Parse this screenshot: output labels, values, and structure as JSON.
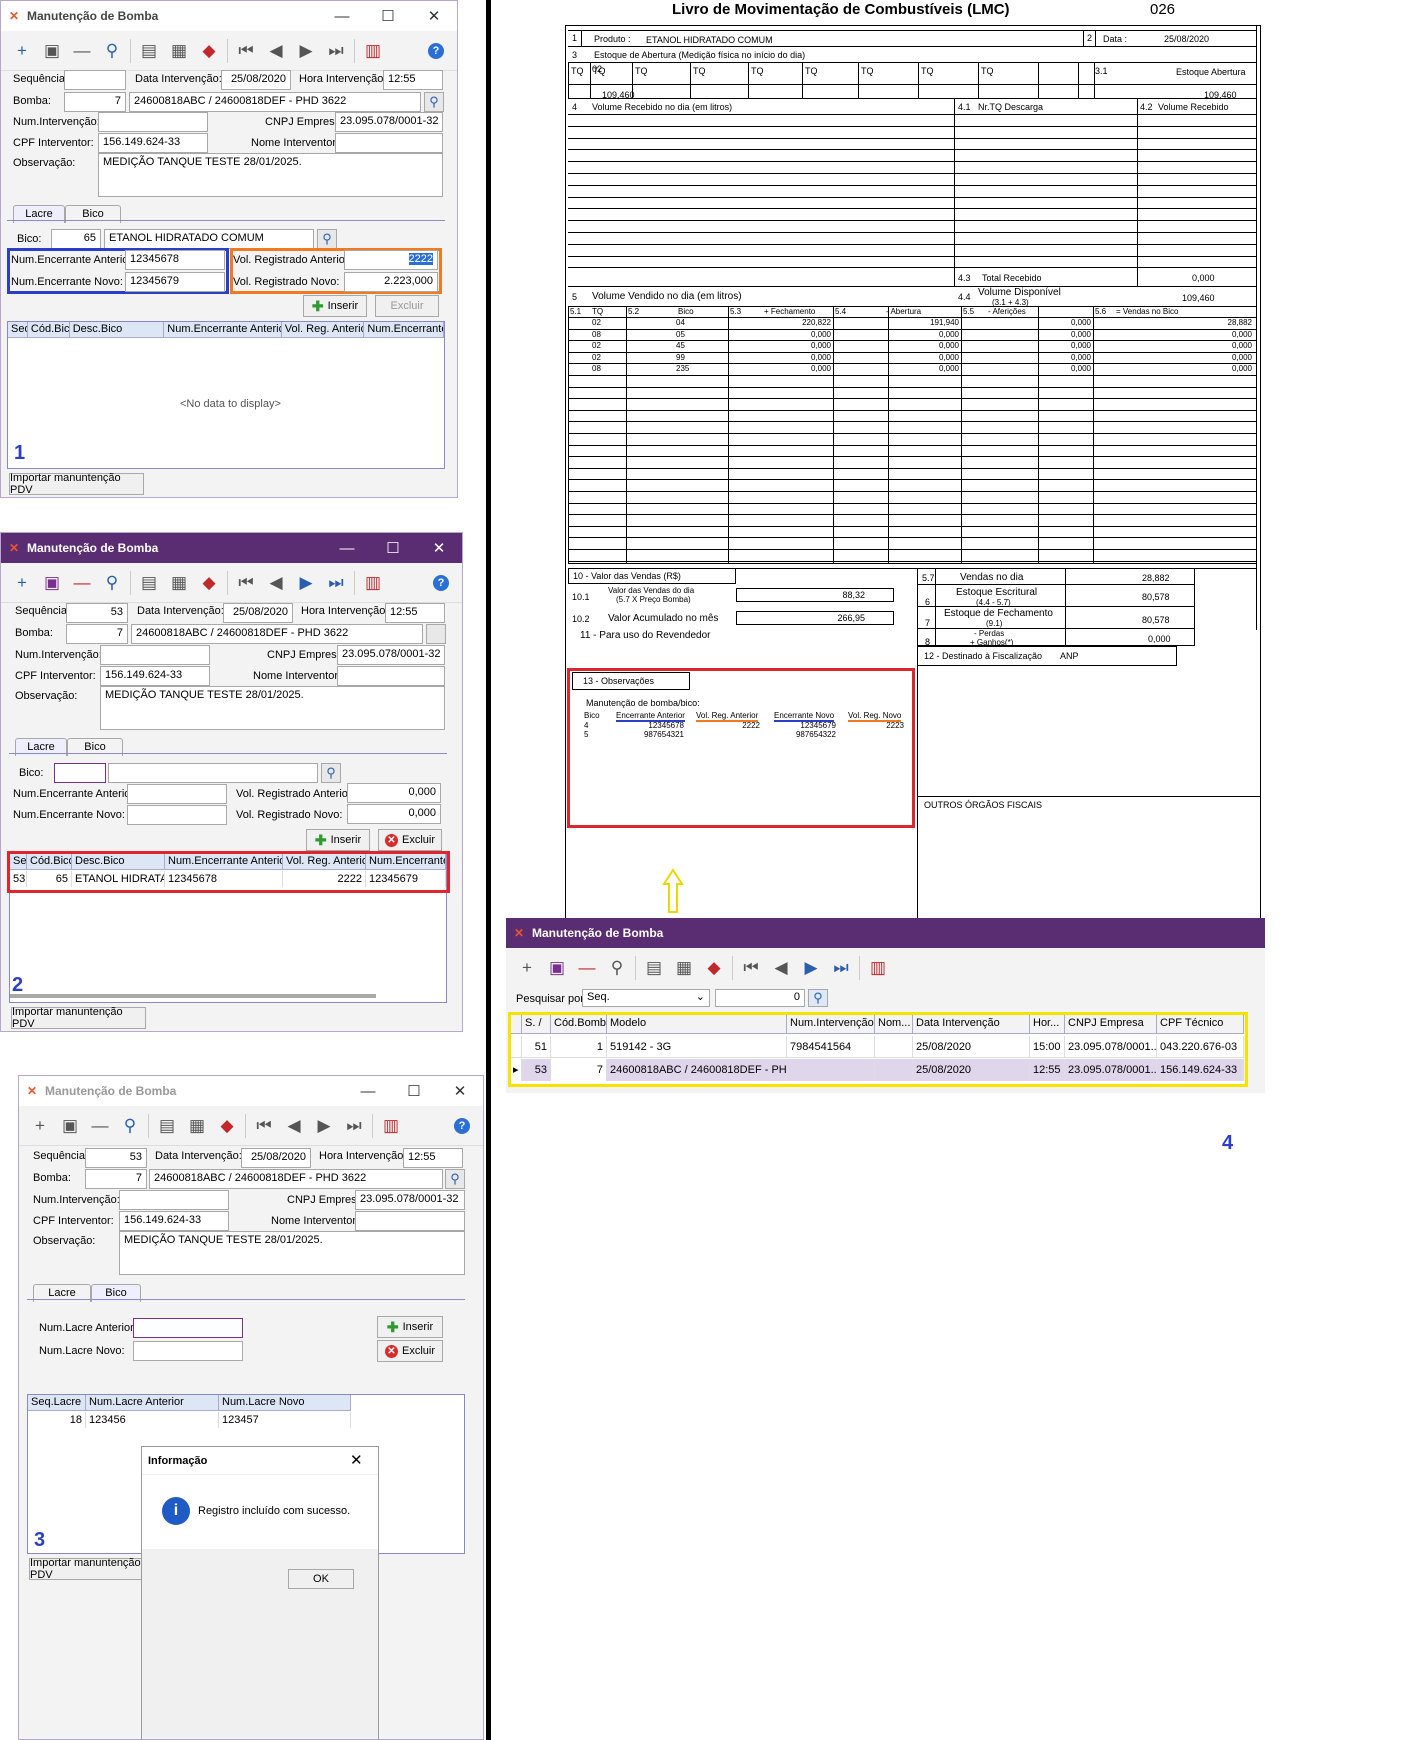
{
  "colors": {
    "accent_purple": "#5a2d72",
    "blue_box": "#2a3fc6",
    "orange_box": "#f07a20",
    "red_box": "#e0262d",
    "yellow_box": "#f5e400",
    "selected_row": "#e0d6ec"
  },
  "win1": {
    "title": "Manutenção de Bomba",
    "labels": {
      "sequencia": "Sequência:",
      "data_intervencao": "Data Intervenção:",
      "hora_intervencao": "Hora Intervenção:",
      "bomba": "Bomba:",
      "num_intervencao": "Num.Intervenção:",
      "cnpj": "CNPJ Empresa:",
      "cpf": "CPF Interventor:",
      "nome": "Nome Interventor:",
      "observacao": "Observação:"
    },
    "values": {
      "sequencia": "",
      "data": "25/08/2020",
      "hora": "12:55",
      "bomba_num": "7",
      "bomba_desc": "24600818ABC / 24600818DEF - PHD 3622",
      "num_intervencao": "",
      "cnpj": "23.095.078/0001-32",
      "cpf": "156.149.624-33",
      "nome": "",
      "observacao": "MEDIÇÃO TANQUE TESTE 28/01/2025."
    },
    "tabs": [
      "Lacre",
      "Bico"
    ],
    "bico_label": "Bico:",
    "bico_num": "65",
    "bico_desc": "ETANOL HIDRATADO COMUM",
    "enc_ant_label": "Num.Encerrante Anterior:",
    "enc_ant": "12345678",
    "enc_novo_label": "Num.Encerrante Novo:",
    "enc_novo": "12345679",
    "vol_ant_label": "Vol. Registrado Anterior:",
    "vol_ant": "2222",
    "vol_novo_label": "Vol. Registrado Novo:",
    "vol_novo": "2.223,000",
    "inserir": "Inserir",
    "excluir": "Excluir",
    "grid_cols": [
      "Seq",
      "Cód.Bico",
      "Desc.Bico",
      "Num.Encerrante Anterior",
      "Vol. Reg. Anterior",
      "Num.Encerrante N"
    ],
    "empty": "<No data to display>",
    "number": "1",
    "importar": "Importar manuntenção PDV"
  },
  "win2": {
    "title": "Manutenção de Bomba",
    "values": {
      "sequencia": "53",
      "data": "25/08/2020",
      "hora": "12:55",
      "bomba_num": "7",
      "bomba_desc": "24600818ABC / 24600818DEF - PHD 3622",
      "num_intervencao": "",
      "cnpj": "23.095.078/0001-32",
      "cpf": "156.149.624-33",
      "nome": "",
      "observacao": "MEDIÇÃO TANQUE TESTE 28/01/2025."
    },
    "bico_num": "",
    "bico_desc": "",
    "enc_ant": "",
    "enc_novo": "",
    "vol_ant": "0,000",
    "vol_novo": "0,000",
    "grid_cols": [
      "Seq",
      "Cód.Bico",
      "Desc.Bico",
      "Num.Encerrante Anterior",
      "Vol. Reg. Anterior",
      "Num.Encerrante N"
    ],
    "row": [
      "53",
      "65",
      "ETANOL HIDRATADO",
      "12345678",
      "2222",
      "12345679"
    ],
    "number": "2",
    "importar": "Importar manuntenção PDV"
  },
  "win3": {
    "title": "Manutenção de Bomba",
    "values": {
      "sequencia": "53",
      "data": "25/08/2020",
      "hora": "12:55",
      "bomba_num": "7",
      "bomba_desc": "24600818ABC / 24600818DEF - PHD 3622",
      "num_intervencao": "",
      "cnpj": "23.095.078/0001-32",
      "cpf": "156.149.624-33",
      "nome": "",
      "observacao": "MEDIÇÃO TANQUE TESTE 28/01/2025."
    },
    "lacre_ant_label": "Num.Lacre Anterior:",
    "lacre_novo_label": "Num.Lacre Novo:",
    "grid_cols": [
      "Seq.Lacre",
      "Num.Lacre Anterior",
      "Num.Lacre Novo"
    ],
    "row": [
      "18",
      "123456",
      "123457"
    ],
    "number": "3",
    "importar": "Importar manuntenção PDV",
    "dialog": {
      "title": "Informação",
      "message": "Registro incluído com sucesso.",
      "ok": "OK"
    }
  },
  "win4": {
    "title": "Manutenção de Bomba",
    "search_label": "Pesquisar por:",
    "search_field": "Seq.",
    "search_value": "0",
    "grid_cols": [
      "S.",
      "Cód.Bomba",
      "Modelo",
      "Num.Intervenção",
      "Nom...",
      "Data Intervenção",
      "Hor...",
      "CNPJ Empresa",
      "CPF Técnico"
    ],
    "rows": [
      [
        "51",
        "1",
        "519142 - 3G",
        "7984541564",
        "",
        "25/08/2020",
        "15:00",
        "23.095.078/0001...",
        "043.220.676-03"
      ],
      [
        "53",
        "7",
        "24600818ABC / 24600818DEF - PHD ...",
        "",
        "",
        "25/08/2020",
        "12:55",
        "23.095.078/0001...",
        "156.149.624-33"
      ]
    ],
    "number": "4"
  },
  "lmc": {
    "title": "Livro de Movimentação de Combustíveis (LMC)",
    "page": "026",
    "produto_label": "Produto :",
    "produto": "ETANOL HIDRATADO COMUM",
    "data_label": "Data :",
    "data": "25/08/2020",
    "estoque_abertura_label": "Estoque de Abertura (Medição física no início do dia)",
    "tq_label": "TQ",
    "tq_first": "02",
    "tq_first_value": "109,460",
    "estoque_abertura_col": "Estoque Abertura",
    "estoque_abertura_total": "109,460",
    "vol_recebido_label": "Volume Recebido no dia (em litros)",
    "nr_tq_descarga": "Nr.TQ Descarga",
    "vol_recebido_col": "Volume Recebido",
    "total_recebido_label": "Total Recebido",
    "total_recebido": "0,000",
    "vol_vendido_label": "Volume Vendido no dia (em litros)",
    "vol_disponivel_label": "Volume Disponível",
    "vol_disponivel_sub": "(3.1 + 4.3)",
    "vol_disponivel": "109,460",
    "vend_cols": [
      "TQ",
      "Bico",
      "+ Fechamento",
      "- Abertura",
      "- Aferições",
      "= Vendas no Bico"
    ],
    "vend_rows": [
      [
        "02",
        "04",
        "220,822",
        "191,940",
        "0,000",
        "28,882"
      ],
      [
        "08",
        "05",
        "0,000",
        "0,000",
        "0,000",
        "0,000"
      ],
      [
        "02",
        "45",
        "0,000",
        "0,000",
        "0,000",
        "0,000"
      ],
      [
        "02",
        "99",
        "0,000",
        "0,000",
        "0,000",
        "0,000"
      ],
      [
        "08",
        "235",
        "0,000",
        "0,000",
        "0,000",
        "0,000"
      ]
    ],
    "valor_vendas_label": "10 - Valor das Vendas    (R$)",
    "valor_vendas_dia_label": "Valor das Vendas do dia",
    "valor_vendas_dia_sub": "(5.7 X Preço Bomba)",
    "valor_vendas_dia": "88,32",
    "valor_acumulado_label": "Valor Acumulado no mês",
    "valor_acumulado": "266,95",
    "uso_revendedor": "11 - Para uso do Revendedor",
    "vendas_no_dia_label": "Vendas no dia",
    "vendas_no_dia": "28,882",
    "estoque_escritural_label": "Estoque Escritural",
    "estoque_escritural_sub": "(4.4 - 5.7)",
    "estoque_escritural": "80,578",
    "estoque_fechamento_label": "Estoque de Fechamento",
    "estoque_fechamento_sub": "(9.1)",
    "estoque_fechamento": "80,578",
    "perdas_label": "- Perdas",
    "ganhos_label": "+ Ganhos(*)",
    "perdas_ganhos": "0,000",
    "destinado": "12 - Destinado à Fiscalização",
    "anp": "ANP",
    "outros": "OUTROS ÓRGÃOS FISCAIS",
    "obs_label": "13 - Observações",
    "obs_title": "Manutenção de bomba/bico:",
    "obs_cols": [
      "Bico",
      "Encerrante Anterior",
      "Vol. Reg. Anterior",
      "Encerrante Novo",
      "Vol. Reg. Novo"
    ],
    "obs_rows": [
      [
        "4",
        "12345678",
        "2222",
        "12345679",
        "2223"
      ],
      [
        "5",
        "987654321",
        "",
        "987654322",
        ""
      ]
    ]
  }
}
